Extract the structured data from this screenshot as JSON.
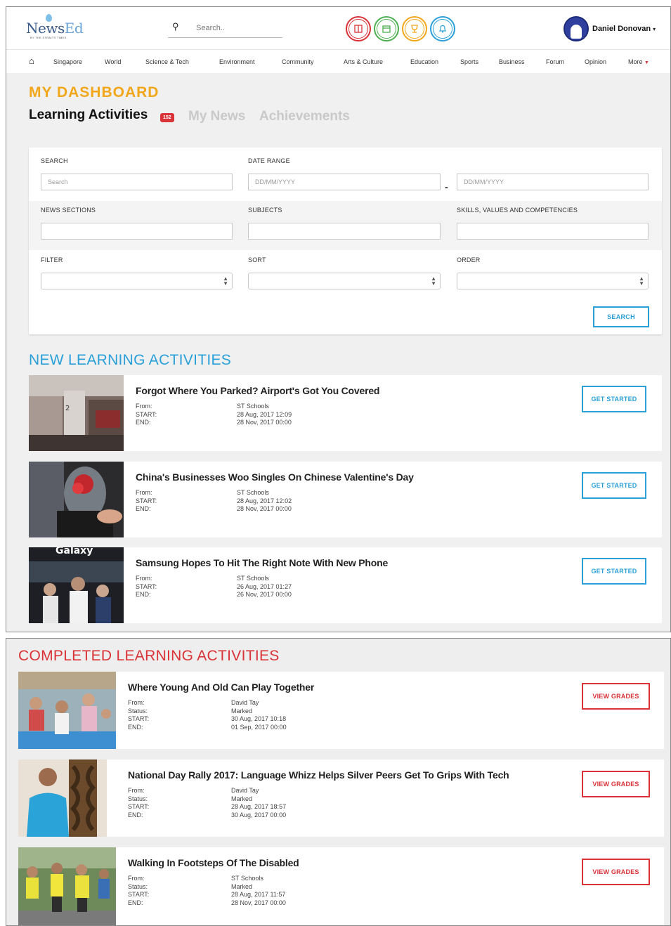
{
  "header": {
    "logo_main": "News",
    "logo_accent": "Ed",
    "logo_sub": "BY THE STRAITS TIMES",
    "search_placeholder": "Search..",
    "user_name": "Daniel Donovan",
    "icons": [
      {
        "name": "book-icon",
        "color": "#d93237"
      },
      {
        "name": "folder-icon",
        "color": "#4caf50"
      },
      {
        "name": "trophy-icon",
        "color": "#f2a61a"
      },
      {
        "name": "bell-icon",
        "color": "#2aa0d8"
      }
    ]
  },
  "nav": {
    "items": [
      "Singapore",
      "World",
      "Science & Tech",
      "Environment",
      "Community",
      "Arts & Culture",
      "Education",
      "Sports",
      "Business",
      "Forum",
      "Opinion"
    ],
    "more": "More"
  },
  "dashboard": {
    "title": "MY DASHBOARD",
    "tabs": [
      "Learning Activities",
      "My News",
      "Achievements"
    ],
    "badge": "152"
  },
  "filters": {
    "search_label": "SEARCH",
    "search_placeholder": "Search",
    "date_range_label": "DATE RANGE",
    "date_placeholder": "DD/MM/YYYY",
    "news_sections_label": "NEWS SECTIONS",
    "subjects_label": "SUBJECTS",
    "skills_label": "SKILLS, VALUES AND COMPETENCIES",
    "filter_label": "FILTER",
    "sort_label": "SORT",
    "order_label": "ORDER",
    "search_button": "SEARCH"
  },
  "new_activities": {
    "title": "NEW LEARNING ACTIVITIES",
    "button_label": "GET STARTED",
    "labels": [
      "From:",
      "START:",
      "END:"
    ],
    "items": [
      {
        "title": "Forgot Where You Parked? Airport's Got You Covered",
        "from": "ST Schools",
        "start": "28 Aug, 2017 12:09",
        "end": "28 Nov, 2017 00:00"
      },
      {
        "title": "China's Businesses Woo Singles On Chinese Valentine's Day",
        "from": "ST Schools",
        "start": "28 Aug, 2017 12:02",
        "end": "28 Nov, 2017 00:00"
      },
      {
        "title": "Samsung Hopes To Hit The Right Note With New Phone",
        "from": "ST Schools",
        "start": "26 Aug, 2017 01:27",
        "end": "26 Nov, 2017 00:00"
      }
    ]
  },
  "completed_activities": {
    "title": "COMPLETED LEARNING ACTIVITIES",
    "button_label": "VIEW GRADES",
    "labels": [
      "From:",
      "Status:",
      "START:",
      "END:"
    ],
    "items": [
      {
        "title": "Where Young And Old Can Play Together",
        "from": "David Tay",
        "status": "Marked",
        "start": "30 Aug, 2017 10:18",
        "end": "01 Sep, 2017 00:00"
      },
      {
        "title": "National Day Rally 2017: Language Whizz Helps Silver Peers Get To Grips With Tech",
        "from": "David Tay",
        "status": "Marked",
        "start": "28 Aug, 2017 18:57",
        "end": "30 Aug, 2017 00:00"
      },
      {
        "title": "Walking In Footsteps Of The Disabled",
        "from": "ST Schools",
        "status": "Marked",
        "start": "28 Aug, 2017 11:57",
        "end": "28 Nov, 2017 00:00"
      }
    ]
  }
}
